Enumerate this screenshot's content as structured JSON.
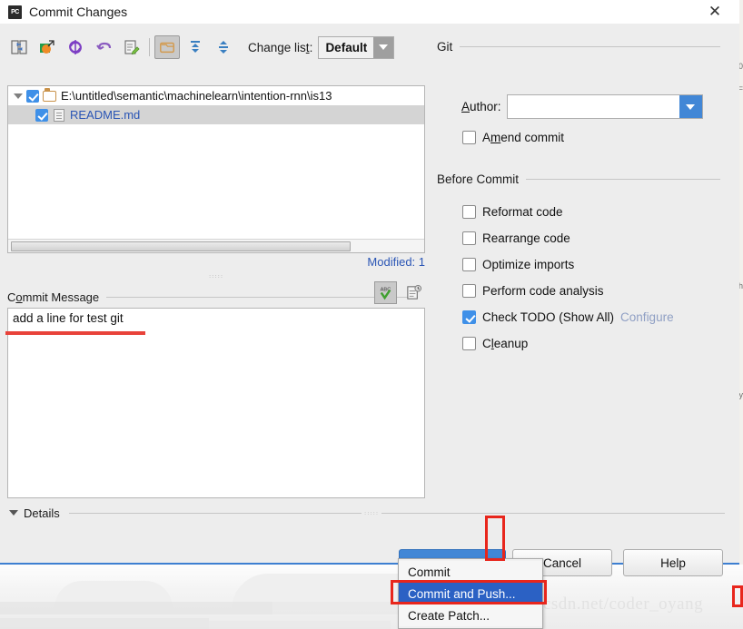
{
  "window": {
    "title": "Commit Changes",
    "app_icon": "pycharm-icon",
    "close_label": "✕"
  },
  "toolbar": {
    "icons": [
      {
        "name": "show-diff-icon",
        "title": "Show Diff"
      },
      {
        "name": "move-to-changelist-icon",
        "title": "Move to Another Changelist"
      },
      {
        "name": "refresh-icon",
        "title": "Refresh"
      },
      {
        "name": "revert-icon",
        "title": "Revert"
      },
      {
        "name": "edit-source-icon",
        "title": "Edit Source"
      },
      {
        "name": "group-by-directory-icon",
        "title": "Group by Directory"
      },
      {
        "name": "expand-all-icon",
        "title": "Expand All"
      },
      {
        "name": "collapse-all-icon",
        "title": "Collapse All"
      }
    ],
    "changelist_label": "Change lis",
    "changelist_label_mnemonic": "t",
    "changelist_label_tail": ":",
    "changelist_value": "Default"
  },
  "file_tree": {
    "root": {
      "path": "E:\\untitled\\semantic\\machinelearn\\intention-rnn\\is13",
      "checked": true,
      "expanded": true,
      "icon": "folder-icon"
    },
    "children": [
      {
        "name": "README.md",
        "checked": true,
        "icon": "file-icon",
        "selected": true
      }
    ],
    "status": "Modified: 1"
  },
  "commit_message": {
    "label_head": "C",
    "label_mnemonic": "o",
    "label_tail": "mmit Message",
    "label_full": "Commit Message",
    "value": "add a line for test git",
    "spellcheck_icon": "spellcheck-abc-icon",
    "history_icon": "commit-history-icon"
  },
  "details": {
    "label": "Details",
    "expanded": true
  },
  "git_group": {
    "title": "Git",
    "author": {
      "label_head": "A",
      "label_mnemonic": "A",
      "label_full": "Author:",
      "value": "",
      "placeholder": ""
    },
    "amend": {
      "label": "Amend commit",
      "mnemonic": "m",
      "checked": false
    }
  },
  "before_commit": {
    "title": "Before Commit",
    "options": [
      {
        "label": "Reformat code",
        "mnemonic": "R",
        "checked": false
      },
      {
        "label": "Rearrange code",
        "mnemonic": "n",
        "checked": false
      },
      {
        "label": "Optimize imports",
        "mnemonic": "O",
        "checked": false
      },
      {
        "label": "Perform code analysis",
        "mnemonic": "y",
        "checked": false
      },
      {
        "label": "Check TODO (Show All)",
        "mnemonic": "",
        "checked": true,
        "link": "Configure"
      },
      {
        "label": "Cleanup",
        "mnemonic": "l",
        "checked": false
      }
    ]
  },
  "buttons": {
    "commit": "Commit",
    "cancel": "Cancel",
    "help": "Help"
  },
  "commit_menu": {
    "items": [
      {
        "label": "Commit",
        "highlighted": false
      },
      {
        "label": "Commit and Push...",
        "highlighted": true
      },
      {
        "label": "Create Patch...",
        "highlighted": false
      }
    ]
  },
  "watermark": "http://blog.csdn.net/coder_oyang",
  "colors": {
    "accent_blue": "#4287d6",
    "checkbox_blue": "#3f90e8",
    "menu_highlight": "#2b61c4",
    "link_blue": "#2a55b5",
    "annotation_red": "#e8261c",
    "spell_error_red": "#e8423a",
    "dialog_border": "#3d7fd1"
  }
}
